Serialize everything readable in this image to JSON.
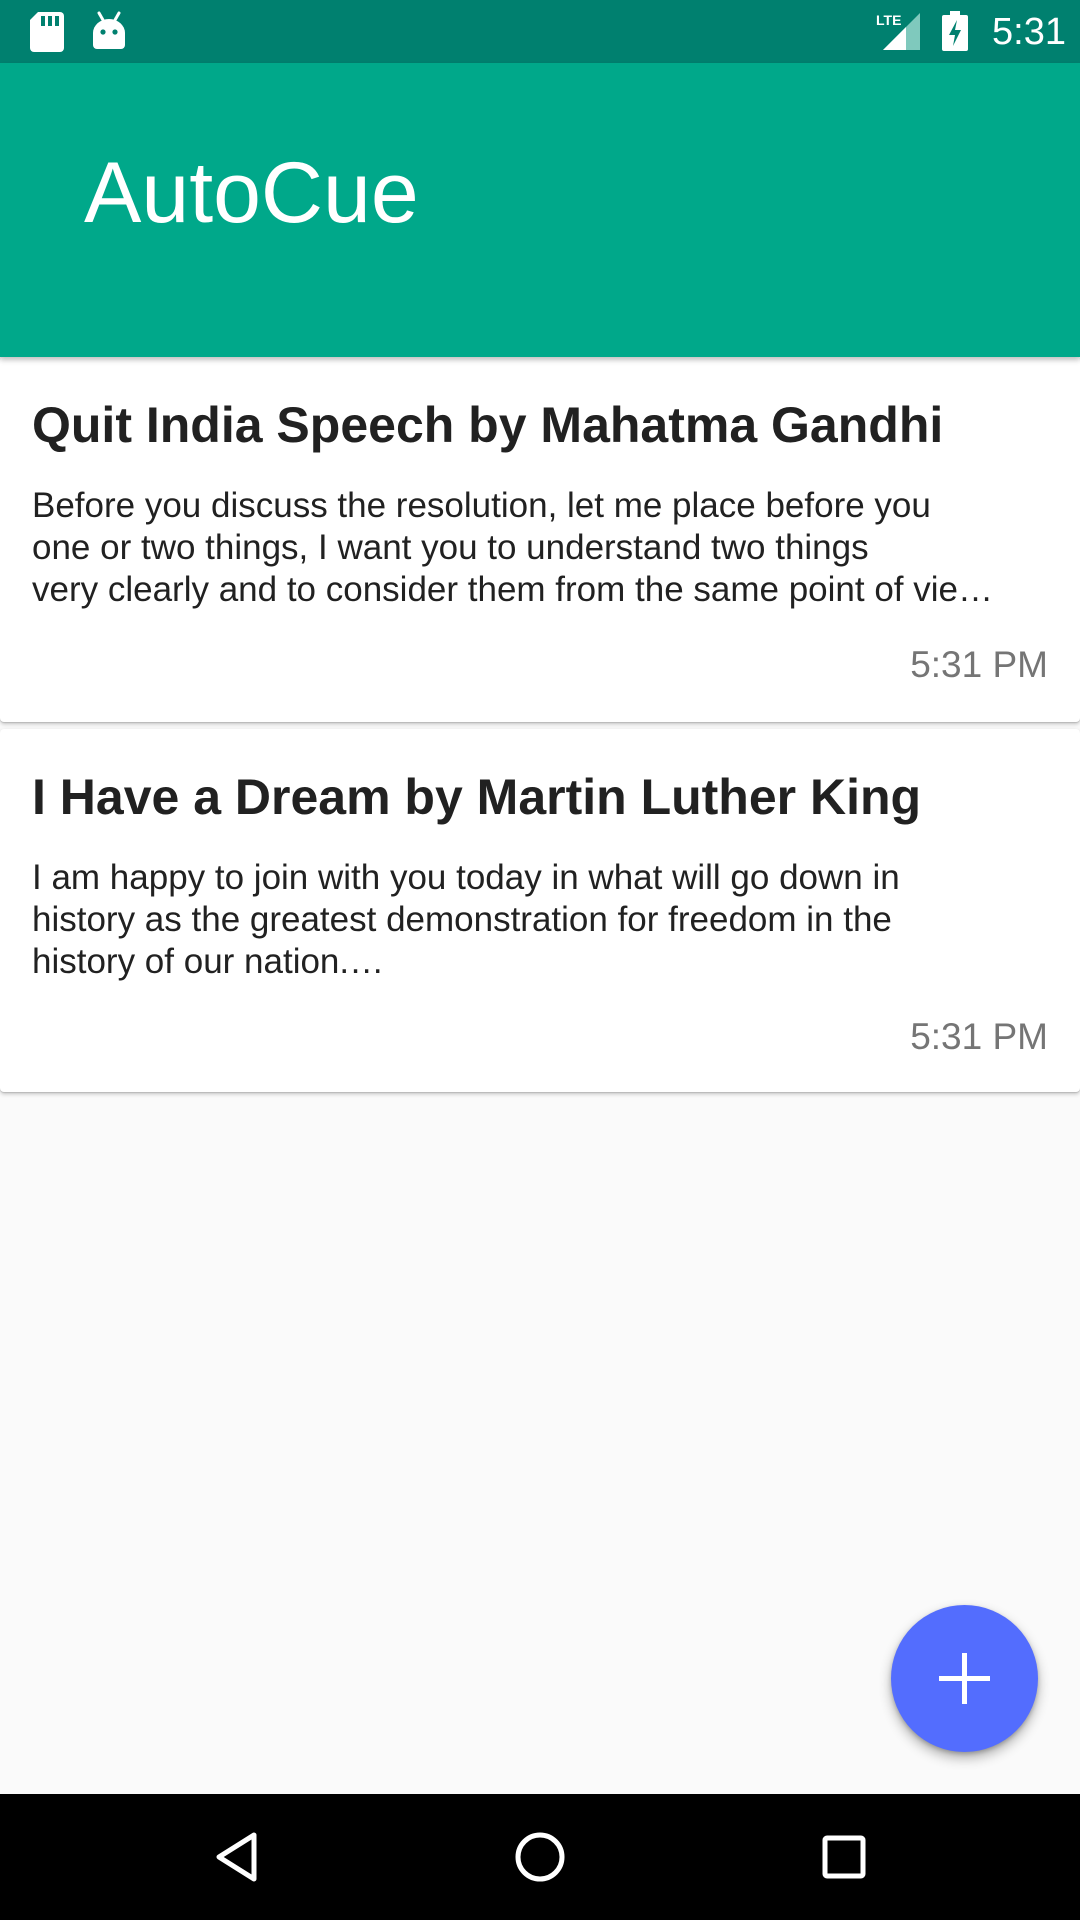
{
  "status_bar": {
    "time": "5:31",
    "network": "LTE",
    "icons": [
      "sd-card-icon",
      "android-icon",
      "lte-signal-icon",
      "battery-charging-icon"
    ]
  },
  "app_bar": {
    "title": "AutoCue",
    "color": "#00a88a",
    "status_color": "#00806f"
  },
  "cards": [
    {
      "title": "Quit India Speech by Mahatma Gandhi",
      "body": "Before you discuss the resolution, let me place before you\none or two things, I want you to understand two things\nvery clearly and to consider them from the same point of vie…",
      "time": "5:31 PM"
    },
    {
      "title": "I Have a Dream by Martin Luther King",
      "body": "I am happy to join with you today in what will go down in\nhistory as the greatest demonstration for freedom in the\nhistory of our nation.…",
      "time": "5:31 PM"
    }
  ],
  "fab": {
    "icon": "plus-icon",
    "color": "#536dfe"
  },
  "nav_bar": {
    "icons": [
      "back-icon",
      "home-icon",
      "recents-icon"
    ]
  }
}
